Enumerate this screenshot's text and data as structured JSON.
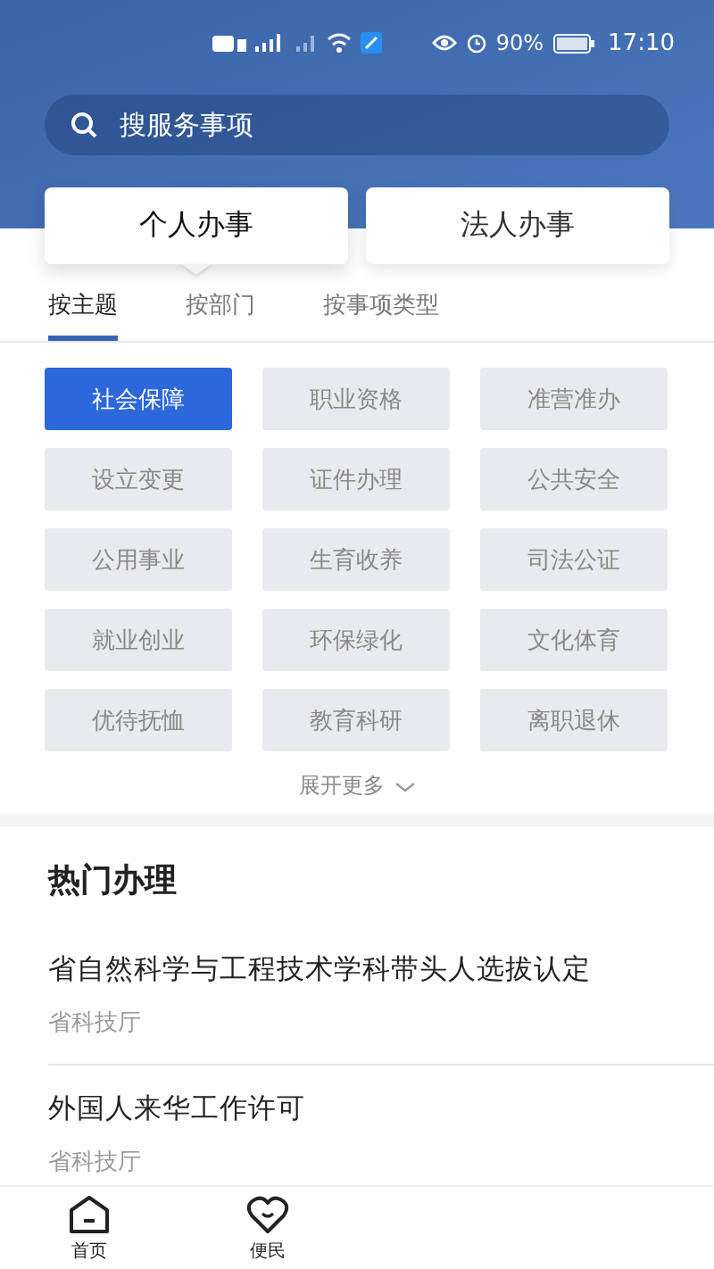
{
  "status_bar": {
    "battery": "90%",
    "time": "17:10"
  },
  "search": {
    "placeholder": "搜服务事项"
  },
  "service_cards": [
    {
      "label": "个人办事",
      "selected": true
    },
    {
      "label": "法人办事",
      "selected": false
    }
  ],
  "tabs": [
    {
      "label": "按主题",
      "selected": true
    },
    {
      "label": "按部门",
      "selected": false
    },
    {
      "label": "按事项类型",
      "selected": false
    }
  ],
  "topics": [
    {
      "label": "社会保障",
      "selected": true
    },
    {
      "label": "职业资格",
      "selected": false
    },
    {
      "label": "准营准办",
      "selected": false
    },
    {
      "label": "设立变更",
      "selected": false
    },
    {
      "label": "证件办理",
      "selected": false
    },
    {
      "label": "公共安全",
      "selected": false
    },
    {
      "label": "公用事业",
      "selected": false
    },
    {
      "label": "生育收养",
      "selected": false
    },
    {
      "label": "司法公证",
      "selected": false
    },
    {
      "label": "就业创业",
      "selected": false
    },
    {
      "label": "环保绿化",
      "selected": false
    },
    {
      "label": "文化体育",
      "selected": false
    },
    {
      "label": "优待抚恤",
      "selected": false
    },
    {
      "label": "教育科研",
      "selected": false
    },
    {
      "label": "离职退休",
      "selected": false
    }
  ],
  "expand_more": "展开更多",
  "popular": {
    "title": "热门办理",
    "items": [
      {
        "title": "省自然科学与工程技术学科带头人选拔认定",
        "department": "省科技厅"
      },
      {
        "title": "外国人来华工作许可",
        "department": "省科技厅"
      }
    ]
  },
  "bottom_nav": [
    {
      "label": "首页",
      "kind": "home"
    },
    {
      "label": "便民",
      "kind": "heart"
    }
  ]
}
